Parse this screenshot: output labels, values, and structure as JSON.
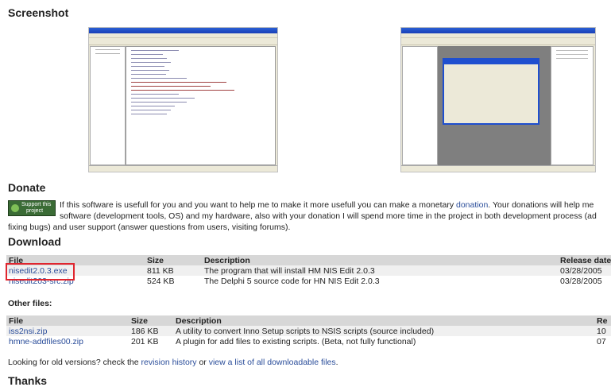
{
  "screenshot": {
    "heading": "Screenshot"
  },
  "donate": {
    "heading": "Donate",
    "button_line1": "Support this",
    "button_line2": "project",
    "line1_before": "If this software is usefull for you and you want to help me to make it more usefull you can make a monetary ",
    "line1_link": "donation",
    "line1_after": ". Your donations will help me",
    "line2": "software (development tools, OS) and my hardware, also with your donation I will spend more time in the project in both development process (ad",
    "line3": "fixing bugs) and user support (answer questions from users, visiting forums)."
  },
  "download": {
    "heading": "Download",
    "columns": [
      "File",
      "Size",
      "Description",
      "Release date"
    ],
    "rows": [
      {
        "file": "nisedit2.0.3.exe",
        "size": "811 KB",
        "description": "The program that will install HM NIS Edit 2.0.3",
        "date": "03/28/2005"
      },
      {
        "file": "nisedit203-src.zip",
        "size": "524 KB",
        "description": "The Delphi 5 source code for HN NIS Edit 2.0.3",
        "date": "03/28/2005"
      }
    ]
  },
  "other": {
    "heading": "Other files:",
    "columns": [
      "File",
      "Size",
      "Description",
      "Re"
    ],
    "rows": [
      {
        "file": "iss2nsi.zip",
        "size": "186 KB",
        "description": "A utility to convert Inno Setup scripts to NSIS scripts (source included)",
        "date": "10"
      },
      {
        "file": "hmne-addfiles00.zip",
        "size": "201 KB",
        "description": "A plugin for add files to existing scripts. (Beta, not fully functional)",
        "date": "07"
      }
    ]
  },
  "old_versions": {
    "before": "Looking for old versions? check the ",
    "link1": "revision history",
    "middle": " or ",
    "link2": "view a list of all downloadable files",
    "after": "."
  },
  "thanks": {
    "heading": "Thanks"
  }
}
